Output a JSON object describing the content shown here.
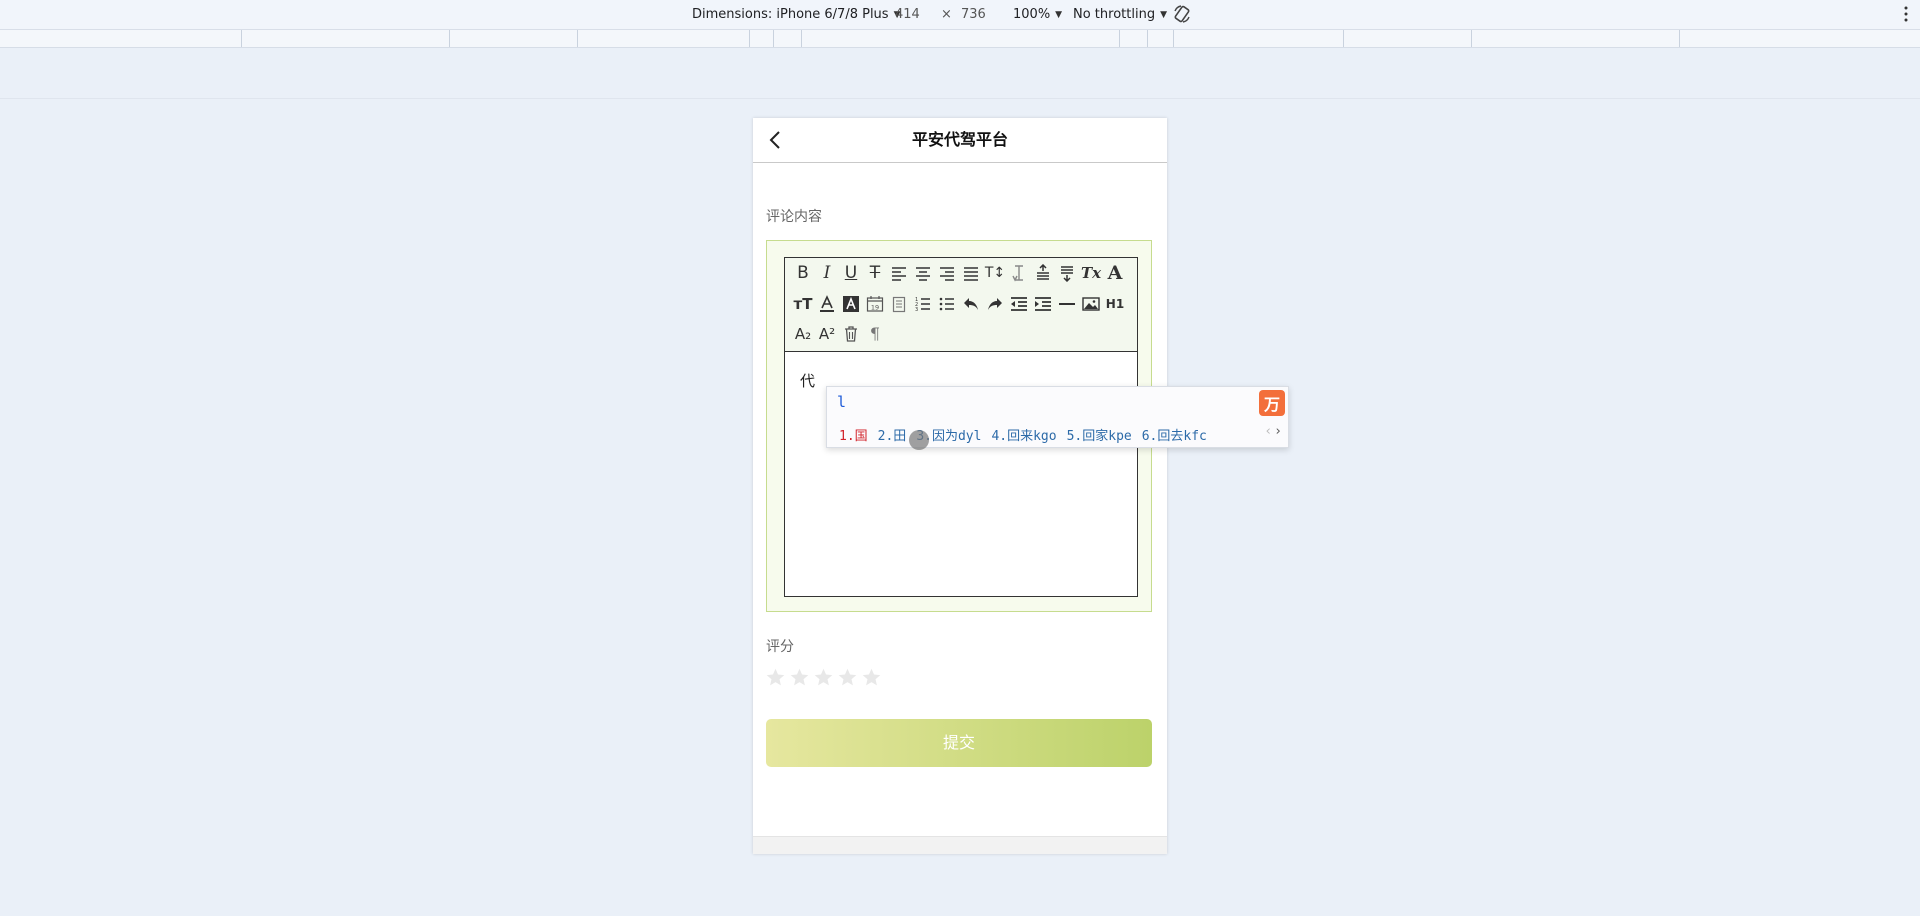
{
  "devtools": {
    "dimensions_label": "Dimensions: iPhone 6/7/8 Plus",
    "width": "414",
    "times": "×",
    "height": "736",
    "zoom": "100%",
    "throttling": "No throttling"
  },
  "nav": {
    "title": "平安代驾平台"
  },
  "form": {
    "comment_label": "评论内容",
    "editor_content": "代",
    "rating_label": "评分",
    "rating_value": 0,
    "rating_max": 5,
    "submit_label": "提交"
  },
  "toolbar": {
    "row1": [
      "bold",
      "italic",
      "underline",
      "strikethrough",
      "align-left",
      "align-center",
      "align-right",
      "align-justify",
      "font-size",
      "line-height",
      "paragraph-spacing-top",
      "paragraph-spacing-bottom",
      "clear-format",
      "font-color"
    ],
    "row2": [
      "font-size-alt",
      "text-color",
      "background-color",
      "date",
      "time",
      "ordered-list",
      "unordered-list",
      "undo",
      "redo",
      "outdent",
      "indent",
      "horizontal-rule",
      "image",
      "heading"
    ],
    "row3": [
      "subscript",
      "superscript",
      "delete",
      "paragraph"
    ],
    "labels": {
      "bold": "B",
      "italic": "I",
      "underline": "U",
      "strikethrough": "T",
      "font_size": "T↕",
      "clear": "Tx",
      "font": "A",
      "heading": "H1",
      "sub": "A₂",
      "sup": "A²",
      "para": "¶"
    }
  },
  "ime": {
    "composition": "l",
    "candidates": [
      "1.国",
      "2.田",
      "3.因为dyl",
      "4.回来kgo",
      "5.回家kpe",
      "6.回去kfc"
    ],
    "logo": "万"
  },
  "colors": {
    "submit_gradient_start": "#e6e79f",
    "submit_gradient_end": "#bcd26a",
    "ime_logo": "#f36f3b",
    "ime_active": "#d2232a"
  }
}
